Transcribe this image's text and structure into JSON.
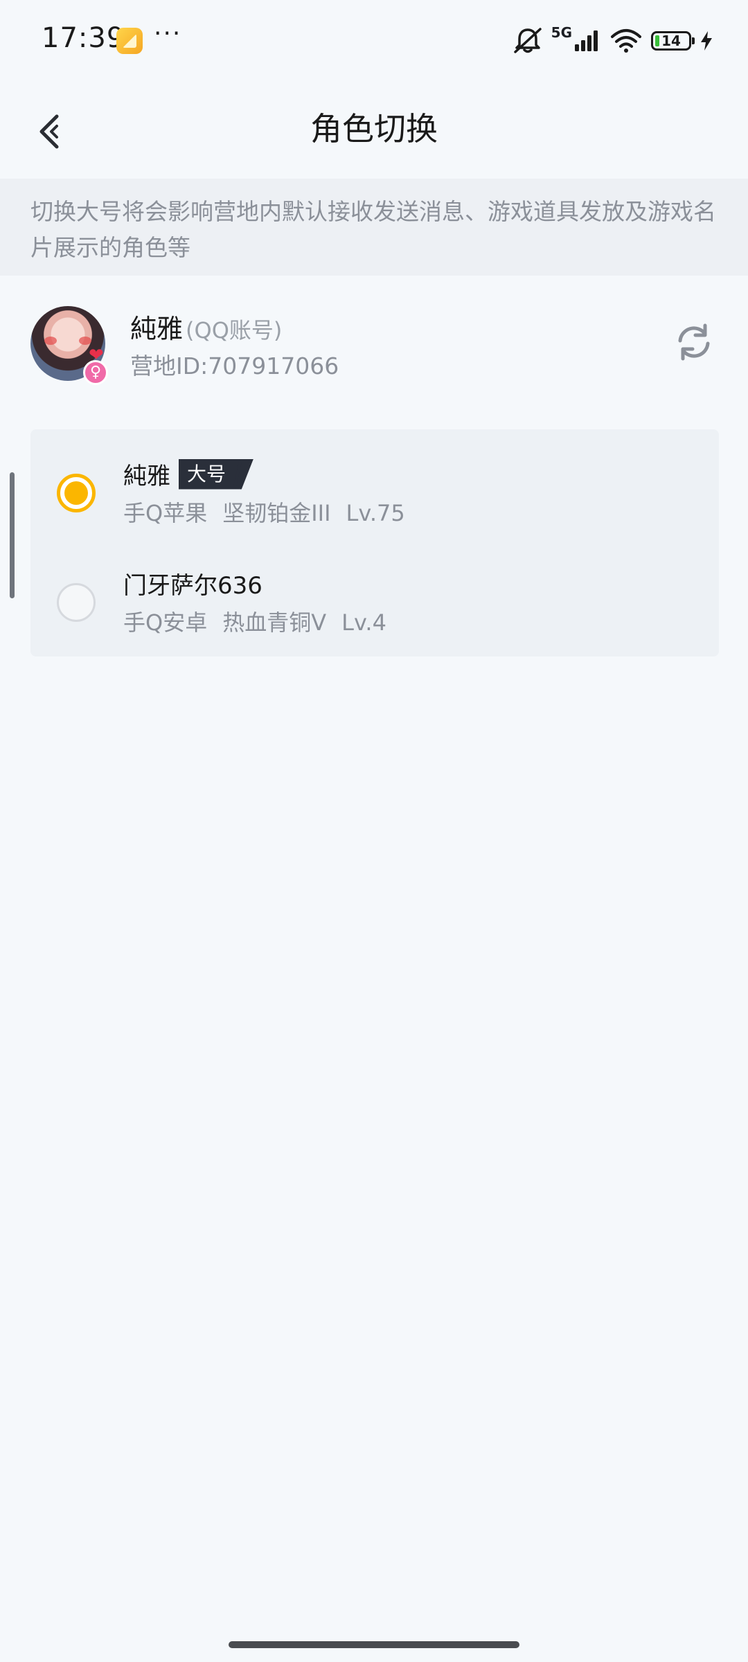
{
  "status_bar": {
    "time": "17:39",
    "app_icon": "note-app-icon",
    "more": "···",
    "network": "5G",
    "battery": "14",
    "icons": [
      "bell-muted-icon",
      "signal-icon",
      "wifi-icon",
      "battery-icon",
      "charging-icon"
    ]
  },
  "header": {
    "title": "角色切换",
    "back_icon": "back-arrow-icon"
  },
  "notice": {
    "text": "切换大号将会影响营地内默认接收发送消息、游戏道具发放及游戏名片展示的角色等"
  },
  "account": {
    "name": "純雅",
    "type": "(QQ账号)",
    "camp_id": "营地ID:707917066",
    "gender_symbol": "♀",
    "gender_color": "#f06aa8"
  },
  "roles": [
    {
      "name": "純雅",
      "badge": "大号",
      "selected": true,
      "platform": "手Q苹果",
      "rank": "坚韧铂金III",
      "level": "Lv.75"
    },
    {
      "name": "门牙萨尔636",
      "badge": "",
      "selected": false,
      "platform": "手Q安卓",
      "rank": "热血青铜V",
      "level": "Lv.4"
    }
  ],
  "colors": {
    "accent": "#fbb600",
    "background": "#f5f8fb",
    "notice_bg": "#edf0f4",
    "card_bg": "#edf1f5",
    "text_primary": "#1a1a1a",
    "text_secondary": "#8b9099",
    "badge_bg": "#2a2f3a"
  }
}
